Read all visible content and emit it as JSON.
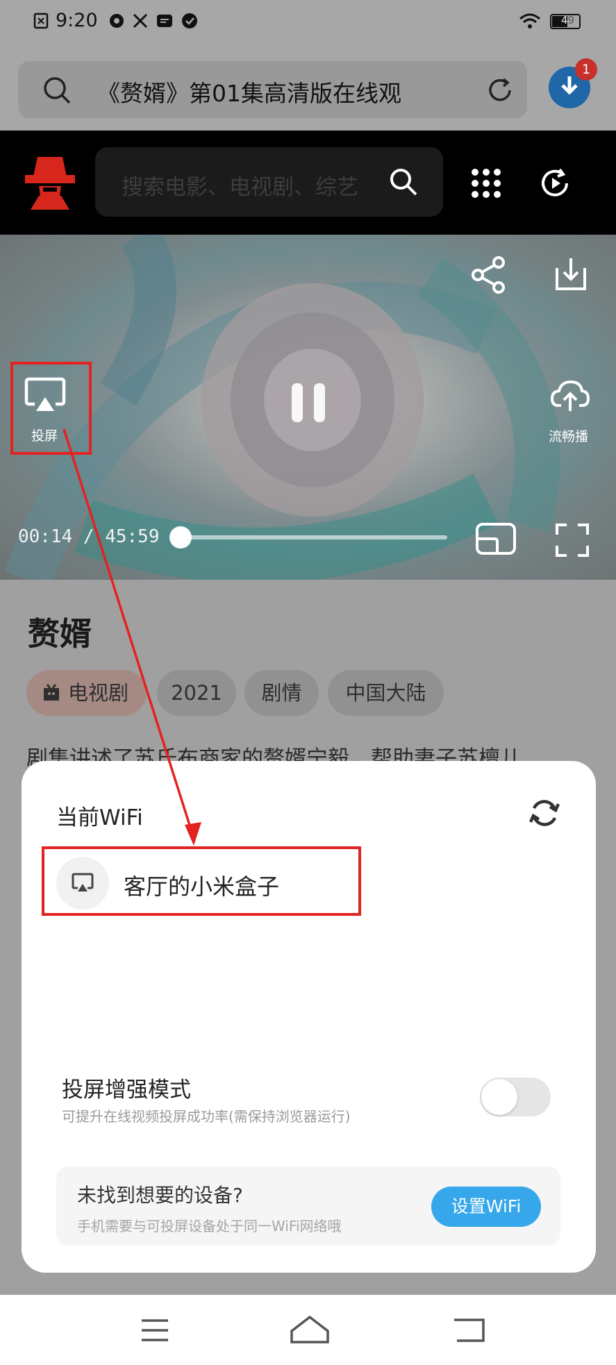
{
  "status_bar": {
    "time": "9:20",
    "battery": "49"
  },
  "browser": {
    "address_text": "《赘婿》第01集高清版在线观",
    "download_badge_count": "1"
  },
  "site": {
    "search_placeholder": "搜索电影、电视剧、综艺"
  },
  "player": {
    "cast_label": "投屏",
    "smooth_label": "流畅播",
    "time": "00:14 / 45:59",
    "progress": 0.005
  },
  "show": {
    "title": "赘婿",
    "tags": [
      "电视剧",
      "2021",
      "剧情",
      "中国大陆"
    ],
    "description": "剧集讲述了苏氏布商家的赘婿宁毅，帮助妻子苏檀儿"
  },
  "cast_sheet": {
    "wifi_label": "当前WiFi",
    "devices": [
      "客厅的小米盒子"
    ],
    "enhance_title": "投屏增强模式",
    "enhance_subtitle": "可提升在线视频投屏成功率(需保持浏览器运行)",
    "enhance_on": false,
    "help_title": "未找到想要的设备?",
    "help_subtitle": "手机需要与可投屏设备处于同一WiFi网络哦",
    "set_wifi_button": "设置WiFi"
  },
  "colors": {
    "accent_blue": "#36a7ea",
    "annotation_red": "#e32222"
  }
}
